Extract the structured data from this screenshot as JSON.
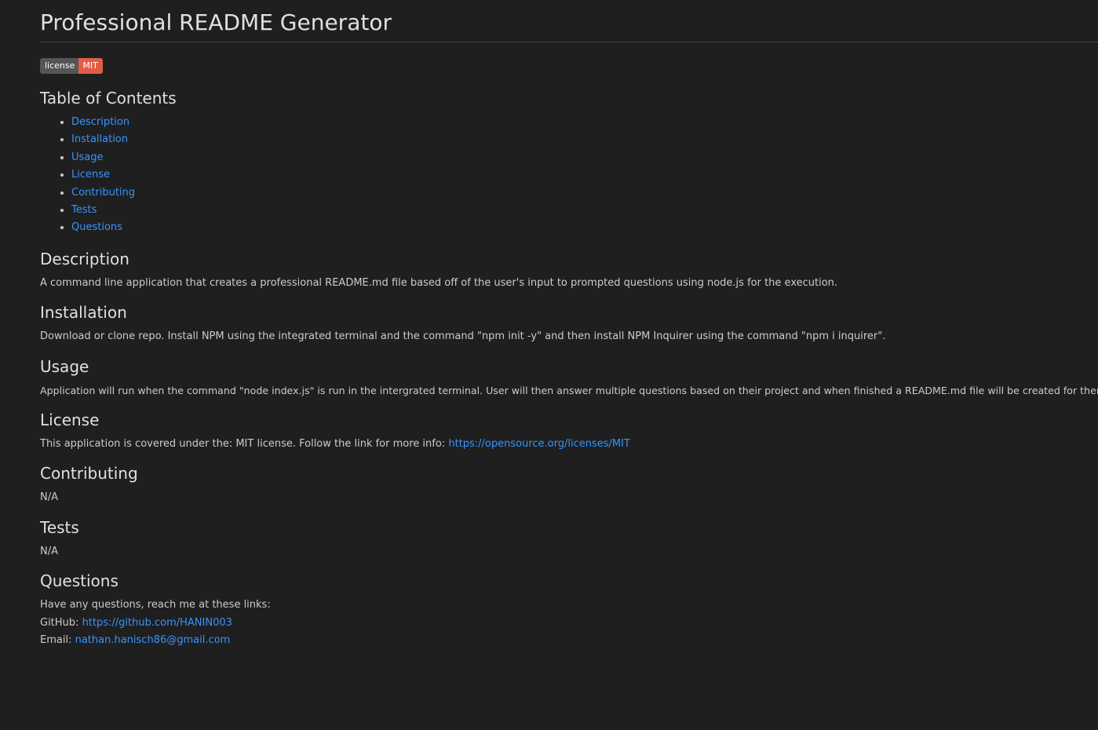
{
  "page": {
    "title": "Professional README Generator"
  },
  "badge": {
    "label": "license",
    "value": "MIT",
    "value_color": "#e05d44"
  },
  "toc": {
    "heading": "Table of Contents",
    "items": [
      "Description",
      "Installation",
      "Usage",
      "License",
      "Contributing",
      "Tests",
      "Questions"
    ]
  },
  "sections": {
    "description": {
      "heading": "Description",
      "text": "A command line application that creates a professional README.md file based off of the user's input to prompted questions using node.js for the execution."
    },
    "installation": {
      "heading": "Installation",
      "text": "Download or clone repo. Install NPM using the integrated terminal and the command \"npm init -y\" and then install NPM Inquirer using the command \"npm i inquirer\"."
    },
    "usage": {
      "heading": "Usage",
      "text": "Application will run when the command \"node index.js\" is run in the intergrated terminal. User will then answer multiple questions based on their project and when finished a README.md file will be created for them."
    },
    "license": {
      "heading": "License",
      "text": "This application is covered under the: MIT license. Follow the link for more info: ",
      "link": "https://opensource.org/licenses/MIT"
    },
    "contributing": {
      "heading": "Contributing",
      "text": "N/A"
    },
    "tests": {
      "heading": "Tests",
      "text": "N/A"
    },
    "questions": {
      "heading": "Questions",
      "intro": "Have any questions, reach me at these links:",
      "github_label": "GitHub: ",
      "github_link": "https://github.com/HANIN003",
      "email_label": "Email: ",
      "email_link": "nathan.hanisch86@gmail.com"
    }
  },
  "colors": {
    "background": "#1f1f1f",
    "text": "#cccccc",
    "heading": "#e0e0e0",
    "link": "#3794ff",
    "badge_label_bg": "#555555"
  }
}
